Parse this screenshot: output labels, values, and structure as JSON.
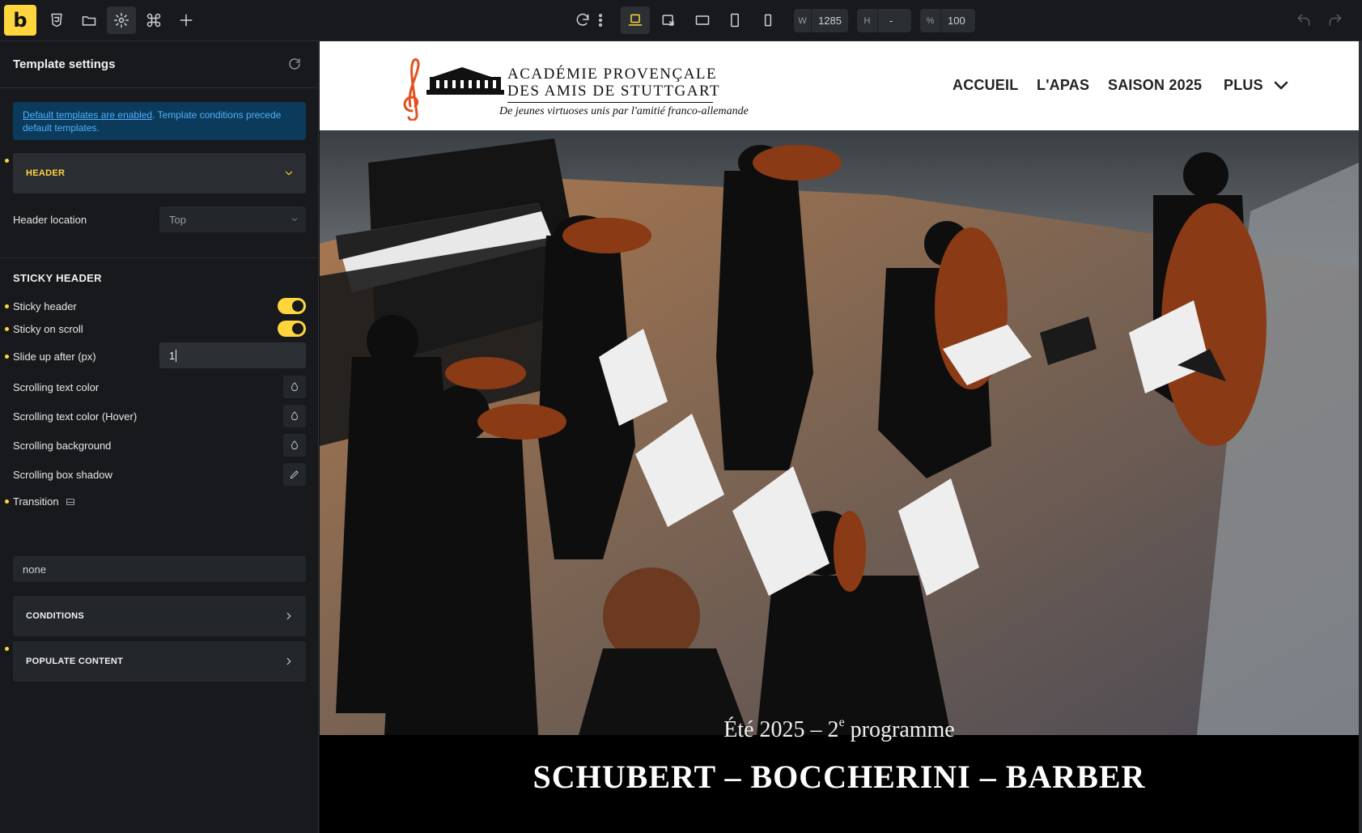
{
  "toolbar": {
    "logo_letter": "b",
    "width_label": "W",
    "width_value": "1285",
    "height_label": "H",
    "height_value": "-",
    "zoom_label": "%",
    "zoom_value": "100",
    "icons": [
      "css3-icon",
      "folder-icon",
      "gear-icon",
      "command-icon",
      "plus-icon",
      "refresh-icon",
      "more-vertical-icon",
      "laptop-icon",
      "tablet-landscape-icon",
      "tablet-wide-icon",
      "tablet-portrait-icon",
      "mobile-icon",
      "undo-icon",
      "redo-icon"
    ],
    "accent_color": "#ffd53e"
  },
  "sidebar": {
    "title": "Template settings",
    "info": {
      "link_text": "Default templates are enabled",
      "rest_text": ". Template conditions precede default templates."
    },
    "header_panel": {
      "label": "HEADER",
      "header_location_label": "Header location",
      "header_location_value": "Top"
    },
    "sticky": {
      "section_title": "STICKY HEADER",
      "sticky_header_label": "Sticky header",
      "sticky_header_on": true,
      "sticky_scroll_label": "Sticky on scroll",
      "sticky_scroll_on": true,
      "slide_up_label": "Slide up after (px)",
      "slide_up_value": "1",
      "text_color_label": "Scrolling text color",
      "text_color_hover_label": "Scrolling text color (Hover)",
      "background_label": "Scrolling background",
      "box_shadow_label": "Scrolling box shadow",
      "transition_label": "Transition",
      "transition_value": "none"
    },
    "conditions_label": "CONDITIONS",
    "populate_label": "POPULATE CONTENT"
  },
  "site": {
    "logo_line1": "ACADÉMIE PROVENÇALE",
    "logo_line2": "DES AMIS DE STUTTGART",
    "logo_tagline": "De jeunes virtuoses unis par l'amitié franco-allemande",
    "nav": [
      "ACCUEIL",
      "L'APAS",
      "SAISON 2025",
      "PLUS"
    ],
    "hero_subtitle_pre": "Été 2025  –  2",
    "hero_subtitle_sup": "e",
    "hero_subtitle_post": " programme",
    "hero_title": "SCHUBERT – BOCCHERINI – BARBER"
  }
}
